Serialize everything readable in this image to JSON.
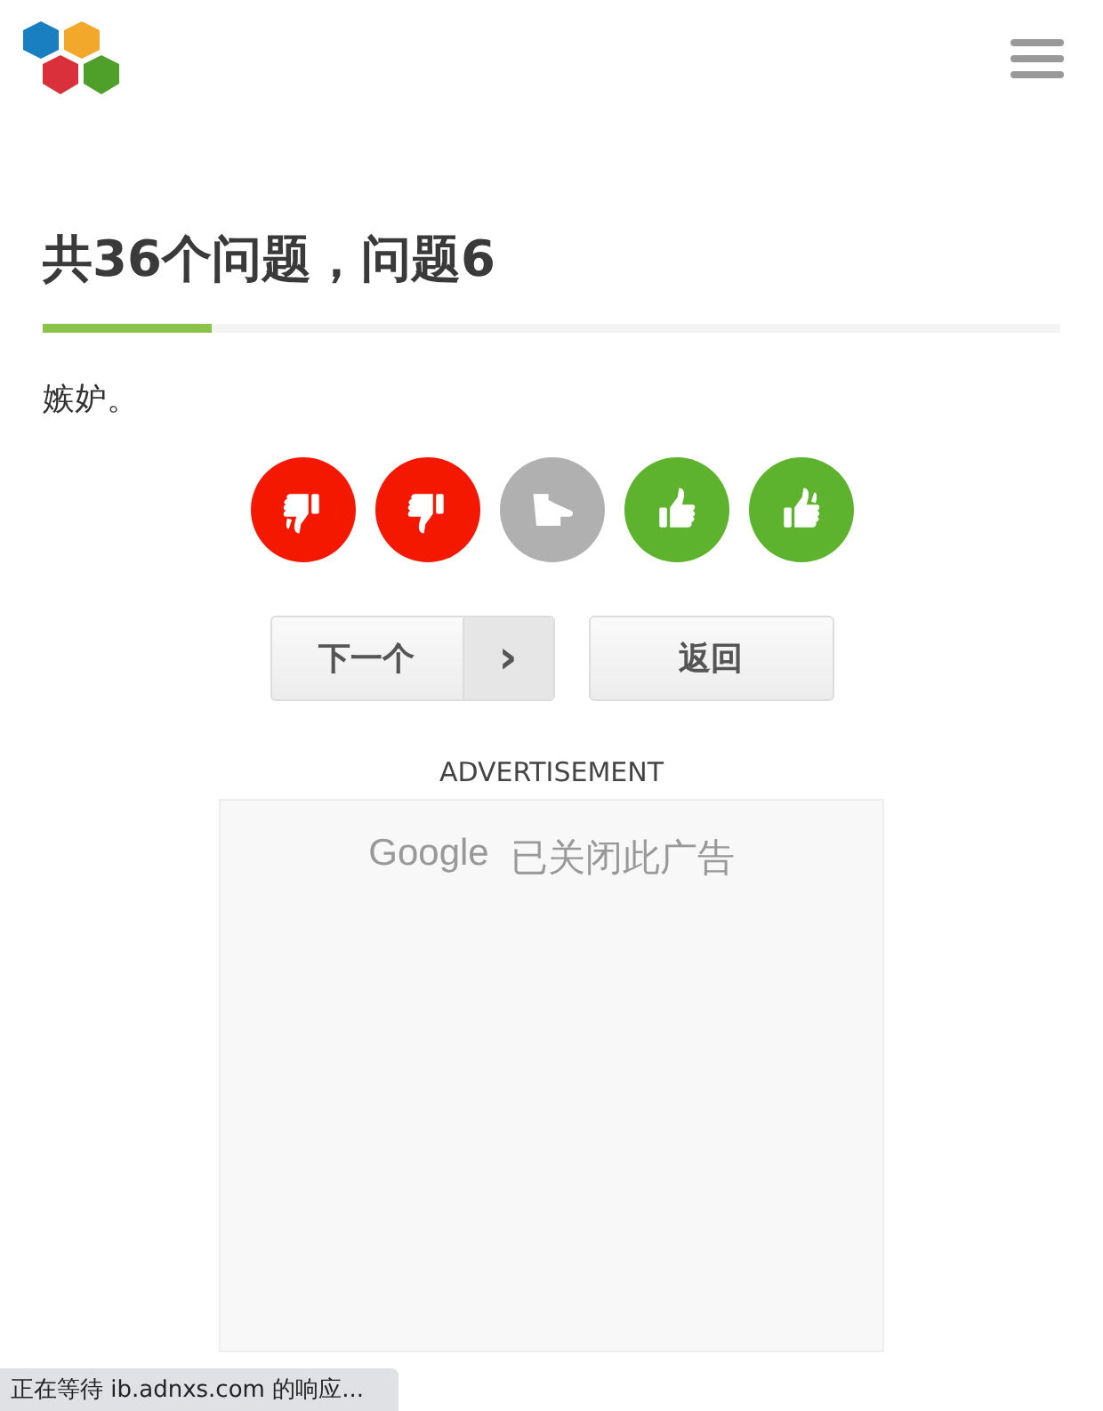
{
  "title": "共36个问题，问题6",
  "progress": {
    "level": 0.166
  },
  "question": "嫉妒。",
  "answers": [
    {
      "kind": "double-down",
      "color": "#f41800"
    },
    {
      "kind": "down",
      "color": "#f41800"
    },
    {
      "kind": "neutral",
      "color": "#b0b0b0"
    },
    {
      "kind": "up",
      "color": "#5db22e"
    },
    {
      "kind": "double-up",
      "color": "#5db22e"
    }
  ],
  "next_button": {
    "label": "下一个",
    "arrow": "›"
  },
  "back_button": {
    "label": "返回"
  },
  "ad": {
    "heading": "ADVERTISEMENT",
    "brand": "Google",
    "message": "已关闭此广告"
  },
  "status_bar": "正在等待 ib.adnxs.com 的响应..."
}
